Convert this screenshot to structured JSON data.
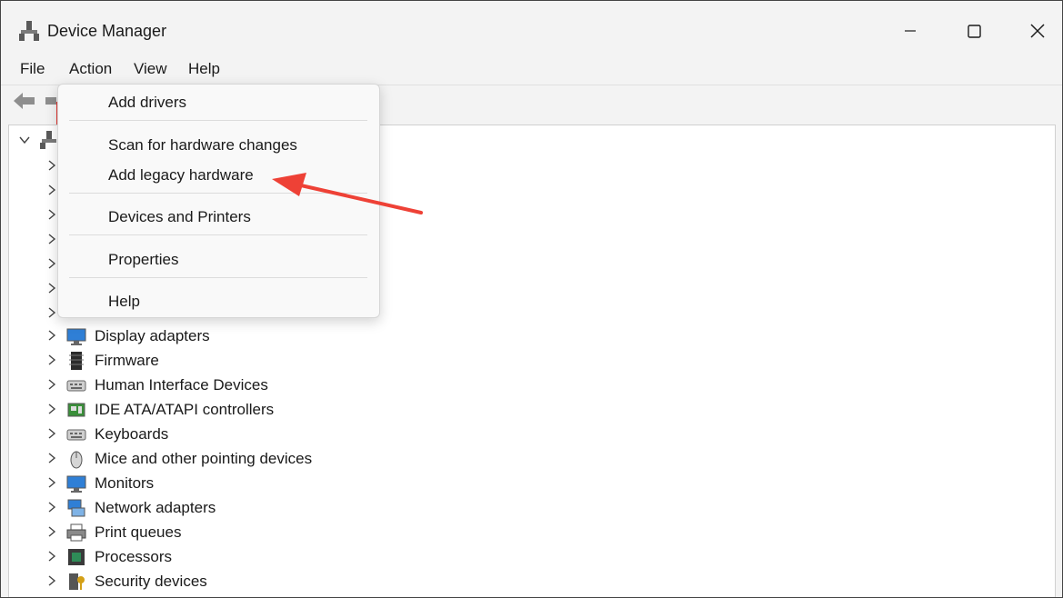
{
  "window": {
    "title": "Device Manager"
  },
  "menubar": {
    "file": "File",
    "action": "Action",
    "view": "View",
    "help": "Help"
  },
  "action_menu": {
    "add_drivers": "Add drivers",
    "scan": "Scan for hardware changes",
    "add_legacy": "Add legacy hardware",
    "devices_printers": "Devices and Printers",
    "properties": "Properties",
    "help": "Help"
  },
  "tree": {
    "categories": [
      {
        "label": "Display adapters",
        "icon": "monitor-icon"
      },
      {
        "label": "Firmware",
        "icon": "chip-icon"
      },
      {
        "label": "Human Interface Devices",
        "icon": "keyboard-icon"
      },
      {
        "label": "IDE ATA/ATAPI controllers",
        "icon": "controller-icon"
      },
      {
        "label": "Keyboards",
        "icon": "keyboard-icon"
      },
      {
        "label": "Mice and other pointing devices",
        "icon": "mouse-icon"
      },
      {
        "label": "Monitors",
        "icon": "monitor-icon"
      },
      {
        "label": "Network adapters",
        "icon": "network-icon"
      },
      {
        "label": "Print queues",
        "icon": "printer-icon"
      },
      {
        "label": "Processors",
        "icon": "processor-icon"
      },
      {
        "label": "Security devices",
        "icon": "security-icon"
      }
    ]
  },
  "colors": {
    "highlight": "#e53935",
    "arrow": "#ee4136"
  }
}
